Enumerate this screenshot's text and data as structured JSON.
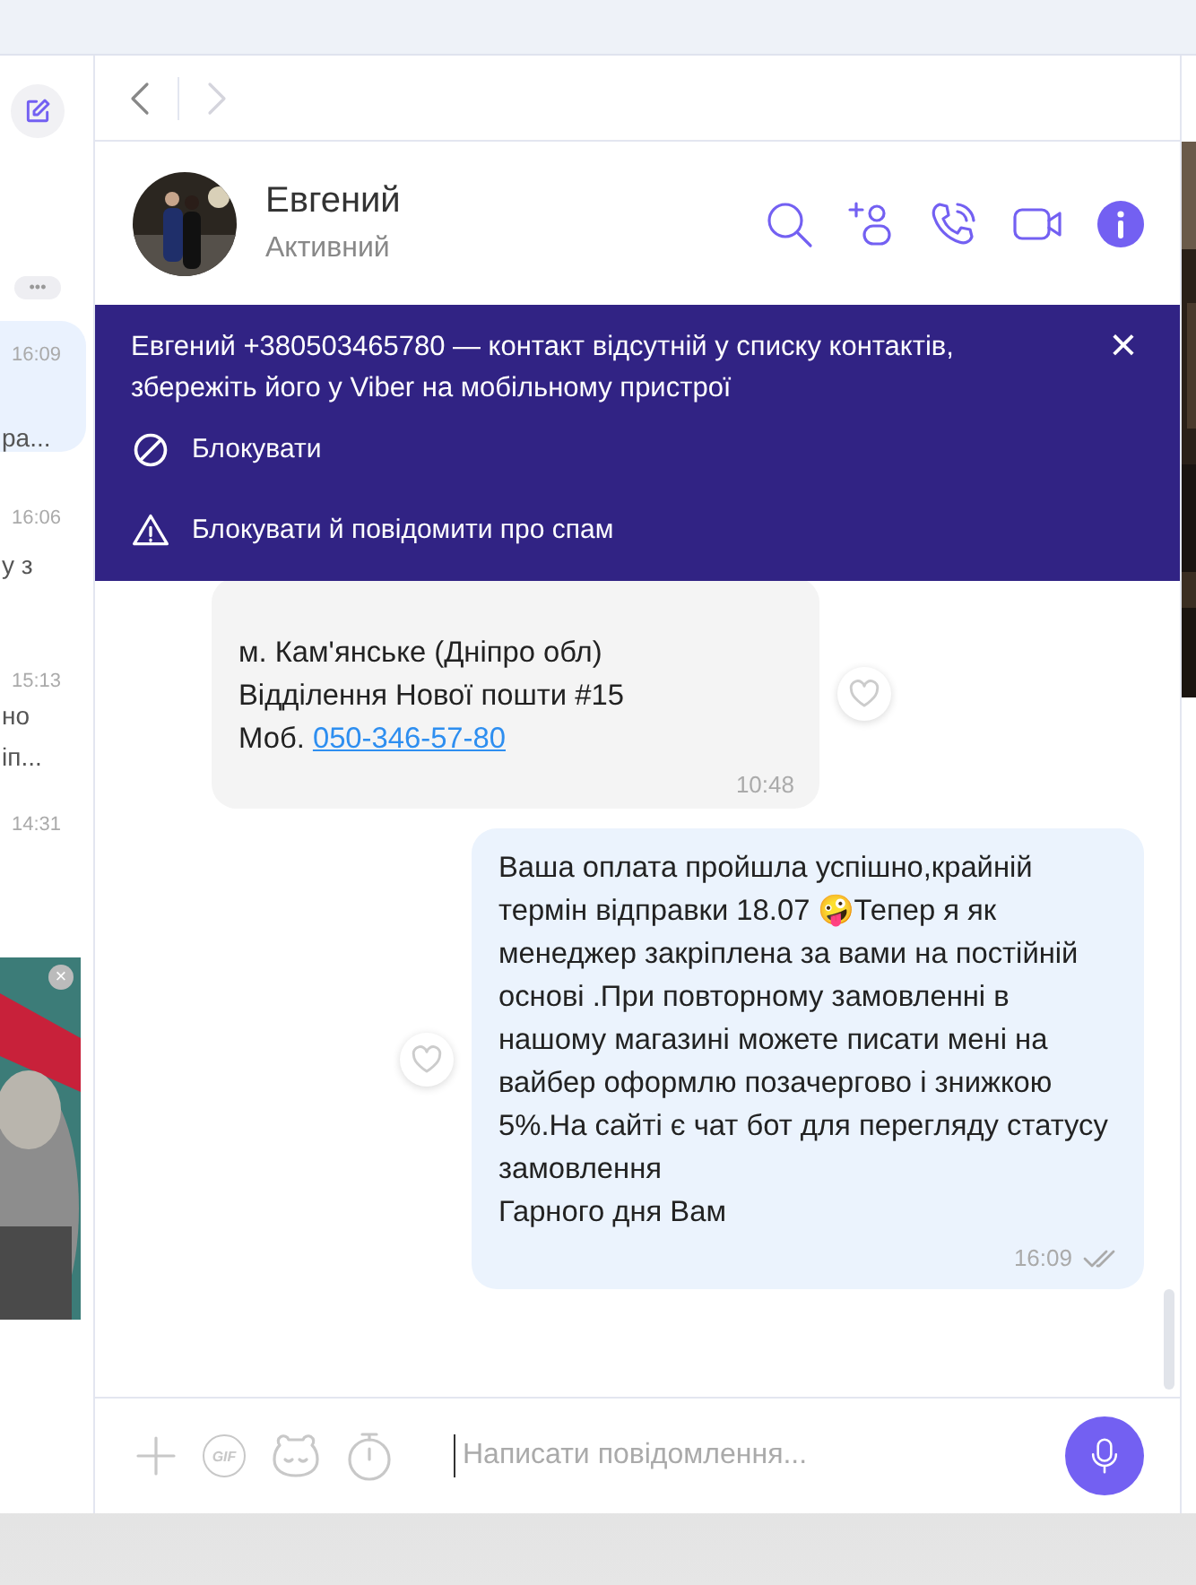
{
  "sidebar": {
    "more_label": "•••",
    "chats": [
      {
        "time": "16:09",
        "snippet": "ра...",
        "selected": true
      },
      {
        "time": "16:06",
        "snippet": "у з",
        "selected": false
      },
      {
        "time": "15:13",
        "snippet": "но\nіп...",
        "selected": false
      },
      {
        "time": "14:31",
        "selected": false
      }
    ],
    "ad": {
      "kind": "picture",
      "close": "×"
    }
  },
  "chat": {
    "contact": {
      "name": "Евгений",
      "status": "Активний"
    },
    "notice": {
      "text": "Евгений +380503465780 — контакт відсутній у списку контактів, збережіть його у Viber на мобільному пристрої",
      "close": "×",
      "actions": [
        {
          "kind": "block",
          "label": "Блокувати"
        },
        {
          "kind": "report",
          "label": "Блокувати й повідомити про спам"
        }
      ]
    },
    "messages": [
      {
        "kind": "incoming",
        "lines": [
          {
            "text": "м. Кам'янське (Дніпро обл)"
          },
          {
            "text": "Відділення Нової пошти #15"
          },
          {
            "text": "Моб. ",
            "link": "050-346-57-80"
          }
        ],
        "time": "10:48"
      },
      {
        "kind": "outgoing",
        "lines": [
          {
            "text": "Ваша оплата пройшла успішно,крайній термін відправки 18.07 🤪Тепер я як менеджер закріплена за вами на постійній основі .При повторному замовленні в нашому магазині можете писати мені на вайбер оформлю позачергово і знижкою 5%.На сайті є чат бот для перегляду статусу замовлення"
          },
          {
            "text": "Гарного дня Вам"
          }
        ],
        "time": "16:09"
      }
    ],
    "composer": {
      "gif_label": "GIF",
      "placeholder": "Написати повідомлення..."
    }
  }
}
